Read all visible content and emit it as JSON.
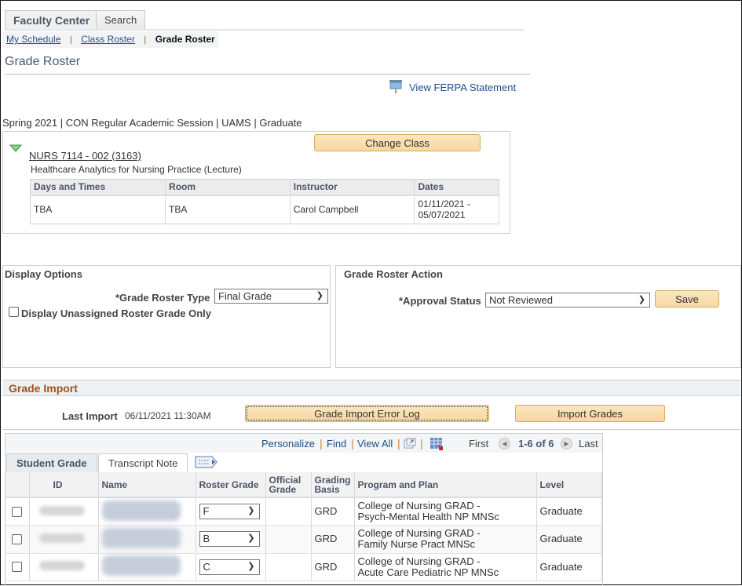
{
  "top_tabs": [
    {
      "label": "Faculty Center",
      "active": true
    },
    {
      "label": "Search",
      "active": false
    }
  ],
  "breadcrumb": {
    "items": [
      {
        "label": "My Schedule",
        "current": false
      },
      {
        "label": "Class Roster",
        "current": false
      },
      {
        "label": "Grade Roster",
        "current": true
      }
    ],
    "separator": "|"
  },
  "page_title": "Grade Roster",
  "ferpa_link": {
    "label": "View FERPA Statement",
    "icon": "presentation-screen-icon"
  },
  "term_line": "Spring 2021 | CON Regular Academic Session | UAMS | Graduate",
  "class_info": {
    "class_link": "NURS 7114 - 002 (3163)",
    "class_description": "Healthcare Analytics for Nursing Practice (Lecture)",
    "change_class_label": "Change Class",
    "meeting_table": {
      "headers": [
        "Days and Times",
        "Room",
        "Instructor",
        "Dates"
      ],
      "rows": [
        [
          "TBA",
          "TBA",
          "Carol Campbell",
          "01/11/2021 - 05/07/2021"
        ]
      ]
    }
  },
  "display_options": {
    "title": "Display Options",
    "roster_type_label": "*Grade Roster Type",
    "roster_type_value": "Final Grade",
    "unassigned_only_label": "Display Unassigned Roster Grade Only",
    "unassigned_only_checked": false
  },
  "roster_action": {
    "title": "Grade Roster Action",
    "approval_status_label": "*Approval Status",
    "approval_status_value": "Not Reviewed",
    "save_label": "Save"
  },
  "grade_import": {
    "title": "Grade Import",
    "last_import_label": "Last Import",
    "last_import_value": "06/11/2021 11:30AM",
    "error_log_label": "Grade Import Error Log",
    "import_label": "Import Grades"
  },
  "grid": {
    "nav": {
      "personalize": "Personalize",
      "find": "Find",
      "view_all": "View All",
      "first": "First",
      "range": "1-6 of 6",
      "last": "Last"
    },
    "tabs": [
      {
        "label": "Student Grade",
        "active": true
      },
      {
        "label": "Transcript Note",
        "active": false
      }
    ],
    "headers": [
      "",
      "ID",
      "Name",
      "Roster Grade",
      "Official Grade",
      "Grading Basis",
      "Program and Plan",
      "Level"
    ],
    "rows": [
      {
        "id": "[redacted]",
        "name": "[redacted]",
        "roster_grade": "F",
        "official_grade": "",
        "grading_basis": "GRD",
        "program_line1": "College of Nursing GRAD -",
        "program_line2": "Psych-Mental Health NP MNSc",
        "level": "Graduate"
      },
      {
        "id": "[redacted]",
        "name": "[redacted]",
        "roster_grade": "B",
        "official_grade": "",
        "grading_basis": "GRD",
        "program_line1": "College of Nursing GRAD -",
        "program_line2": "Family Nurse Pract MNSc",
        "level": "Graduate"
      },
      {
        "id": "[redacted]",
        "name": "[redacted]",
        "roster_grade": "C",
        "official_grade": "",
        "grading_basis": "GRD",
        "program_line1": "College of Nursing GRAD -",
        "program_line2": "Acute Care Pediatric NP MNSc",
        "level": "Graduate"
      }
    ]
  },
  "colors": {
    "button_bg": "#f7d8a0",
    "link": "#1d4e89",
    "section_header": "#a0521d"
  }
}
